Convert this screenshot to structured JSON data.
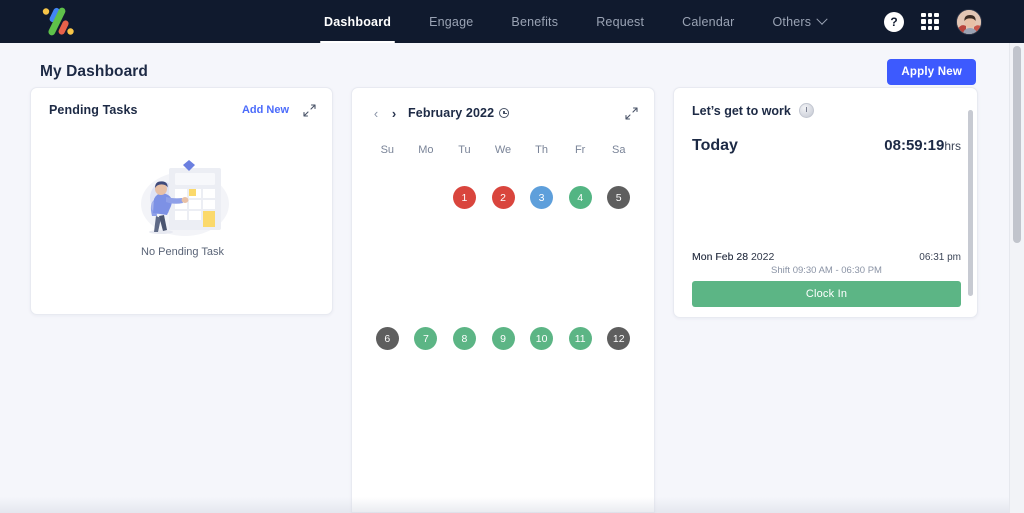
{
  "brand": {
    "logo_name": "percent-logo",
    "colors": {
      "green": "#5ec14a",
      "blue": "#4285f4",
      "orange": "#e8614a",
      "yellow": "#f7c548"
    }
  },
  "navbar": {
    "links": [
      {
        "label": "Dashboard",
        "active": true
      },
      {
        "label": "Engage",
        "active": false
      },
      {
        "label": "Benefits",
        "active": false
      },
      {
        "label": "Request",
        "active": false
      },
      {
        "label": "Calendar",
        "active": false
      },
      {
        "label": "Others",
        "active": false,
        "has_chevron": true
      }
    ],
    "help_label": "?",
    "apps_icon": "grid-icon",
    "avatar_icon": "user-avatar"
  },
  "page": {
    "title": "My Dashboard",
    "apply_button": "Apply New"
  },
  "pending_tasks": {
    "title": "Pending Tasks",
    "add_new": "Add New",
    "expand_icon": "expand-icon",
    "empty_text": "No Pending Task",
    "illustration": "person-with-checklist"
  },
  "calendar": {
    "prev_icon": "‹",
    "next_icon": "›",
    "month": "February 2022",
    "info_icon": "info-icon",
    "expand_icon": "expand-icon",
    "weekdays": [
      "Su",
      "Mo",
      "Tu",
      "We",
      "Th",
      "Fr",
      "Sa"
    ],
    "weeks": [
      [
        {
          "label": "",
          "color": ""
        },
        {
          "label": "",
          "color": ""
        },
        {
          "label": "1",
          "color": "#d9453d"
        },
        {
          "label": "2",
          "color": "#d9453d"
        },
        {
          "label": "3",
          "color": "#5e9fdb"
        },
        {
          "label": "4",
          "color": "#53b583"
        },
        {
          "label": "5",
          "color": "#5e5e5e"
        }
      ],
      [
        {
          "label": "6",
          "color": "#5e5e5e"
        },
        {
          "label": "7",
          "color": "#5cb585"
        },
        {
          "label": "8",
          "color": "#5cb585"
        },
        {
          "label": "9",
          "color": "#5cb585"
        },
        {
          "label": "10",
          "color": "#5cb585"
        },
        {
          "label": "11",
          "color": "#5cb585"
        },
        {
          "label": "12",
          "color": "#5e5e5e"
        }
      ]
    ]
  },
  "work": {
    "title": "Let’s get to work",
    "clock_icon": "clock-icon",
    "today_label": "Today",
    "today_time": "08:59:19",
    "today_time_unit": "hrs",
    "shift_date": "Mon Feb 28 2022",
    "shift_date_overlap": "Mon Feb 28",
    "shift_clock": "06:31 pm",
    "shift_hours": "Shift 09:30 AM - 06:30 PM",
    "clock_in_button": "Clock In",
    "clock_in_color": "#5cb585"
  }
}
